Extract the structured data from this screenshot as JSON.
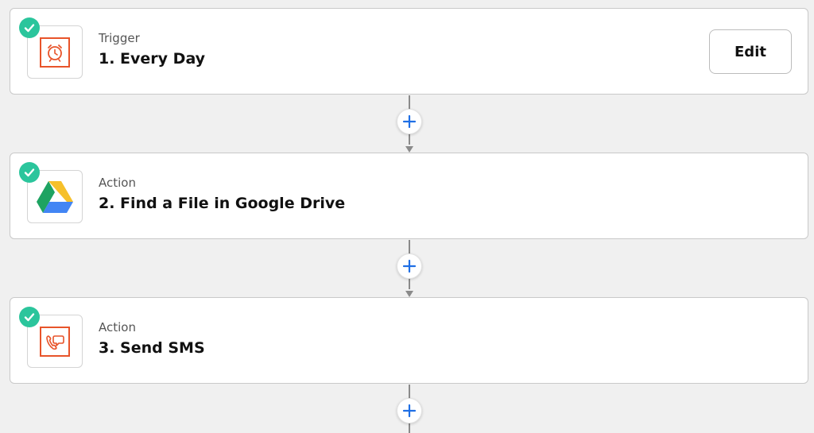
{
  "steps": [
    {
      "type": "Trigger",
      "title": "1. Every Day",
      "icon": "alarm-clock-icon",
      "icon_color": "#e8542a",
      "completed": true
    },
    {
      "type": "Action",
      "title": "2. Find a File in Google Drive",
      "icon": "google-drive-icon",
      "completed": true
    },
    {
      "type": "Action",
      "title": "3. Send SMS",
      "icon": "sms-phone-icon",
      "icon_color": "#e8542a",
      "completed": true
    }
  ],
  "edit_button": {
    "label": "Edit"
  },
  "colors": {
    "check": "#2bc59c",
    "add": "#1f6fe5",
    "connector": "#8a8a8a",
    "background": "#f0f0f0"
  }
}
